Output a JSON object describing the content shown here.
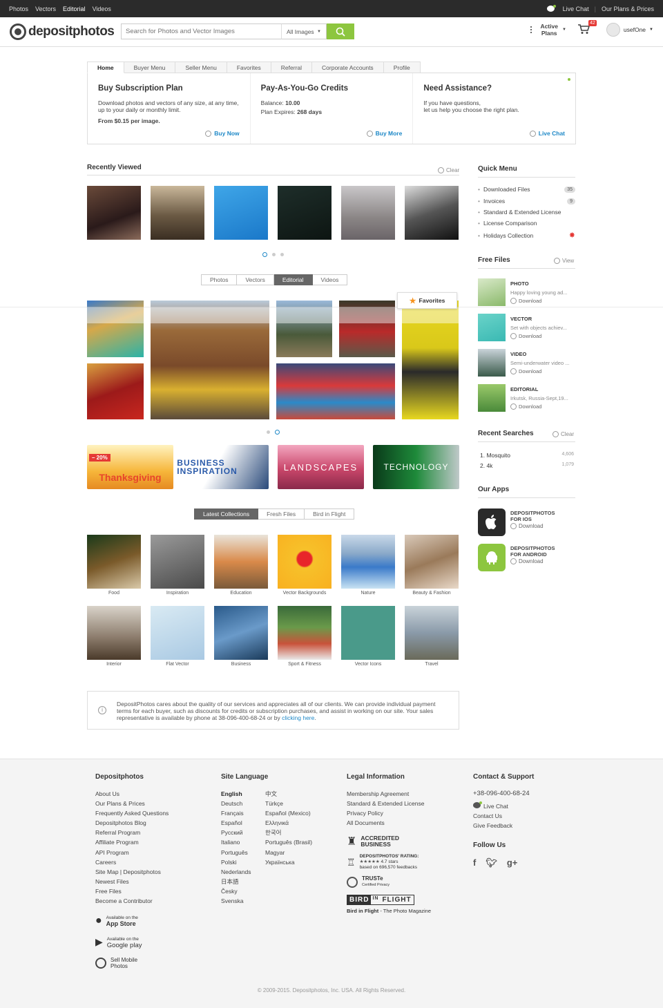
{
  "topbar": {
    "nav": [
      "Photos",
      "Vectors",
      "Editorial",
      "Videos"
    ],
    "live_chat": "Live Chat",
    "plans": "Our Plans & Prices"
  },
  "header": {
    "logo": "depositphotos",
    "search_placeholder": "Search for Photos and Vector Images",
    "search_filter": "All Images",
    "active_plans_1": "Active",
    "active_plans_2": "Plans",
    "cart_count": "42",
    "username": "usefOne"
  },
  "account": {
    "tabs": [
      "Home",
      "Buyer Menu",
      "Seller Menu",
      "Favorites",
      "Referral",
      "Corporate Accounts",
      "Profile"
    ],
    "subscription": {
      "title": "Buy Subscription Plan",
      "text": "Download photos and vectors of any size, at any time, up to your daily or monthly limit.",
      "price_prefix": "From ",
      "price": "$0.15 per image.",
      "link": "Buy Now"
    },
    "credits": {
      "title": "Pay-As-You-Go Credits",
      "balance_label": "Balance: ",
      "balance": "10.00",
      "expires_label": "Plan Expires: ",
      "expires": "268 days",
      "link": "Buy More"
    },
    "assist": {
      "title": "Need Assistance?",
      "line1": "If you have questions,",
      "line2": "let us help you choose the right plan.",
      "link": "Live Chat"
    }
  },
  "recently_viewed": {
    "title": "Recently Viewed",
    "clear": "Clear"
  },
  "media_tabs": [
    "Photos",
    "Vectors",
    "Editorial",
    "Videos"
  ],
  "favorites_label": "Favorites",
  "banners": [
    {
      "text": "Thanksgiving",
      "badge": "– 20%"
    },
    {
      "text": "BUSINESS INSPIRATION"
    },
    {
      "text": "LANDSCAPES"
    },
    {
      "text": "TECHNOLOGY"
    }
  ],
  "collection_tabs": [
    "Latest Collections",
    "Fresh Files",
    "Bird in Flight"
  ],
  "collections": [
    "Food",
    "Inspiration",
    "Education",
    "Vector Backgrounds",
    "Nature",
    "Beauty & Fashion",
    "Interior",
    "Flat Vector",
    "Business",
    "Sport & Fitness",
    "Vector Icons",
    "Travel"
  ],
  "info": {
    "text": "DepositPhotos cares about the quality of our services and appreciates all of our clients. We can provide individual payment terms for each buyer, such as discounts for credits or subscription purchases, and assist in working on our site. Your sales representative is available by phone at 38-096-400-68-24 or by ",
    "link": "clicking here",
    "end": "."
  },
  "quick_menu": {
    "title": "Quick Menu",
    "items": [
      {
        "label": "Downloaded Files",
        "count": "35"
      },
      {
        "label": "Invoices",
        "count": "9"
      },
      {
        "label": "Standard & Extended License",
        "count": ""
      },
      {
        "label": "License Comparison",
        "count": ""
      },
      {
        "label": "Holidays Collection",
        "count": ""
      }
    ]
  },
  "free_files": {
    "title": "Free Files",
    "view": "View",
    "download": "Download",
    "items": [
      {
        "type": "PHOTO",
        "desc": "Happy loving young ad..."
      },
      {
        "type": "VECTOR",
        "desc": "Set with objects achiev..."
      },
      {
        "type": "VIDEO",
        "desc": "Semi-underwater video ..."
      },
      {
        "type": "EDITORIAL",
        "desc": "Irkutsk, Russia-Sept,19..."
      }
    ]
  },
  "recent_searches": {
    "title": "Recent Searches",
    "clear": "Clear",
    "items": [
      {
        "label": "1.  Mosquito",
        "count": "4,606"
      },
      {
        "label": "2.  4k",
        "count": "1,079"
      }
    ]
  },
  "apps": {
    "title": "Our Apps",
    "ios_1": "DEPOSITPHOTOS",
    "ios_2": "FOR IOS",
    "android_1": "DEPOSITPHOTOS",
    "android_2": "FOR ANDROID",
    "download": "Download"
  },
  "footer": {
    "col1_title": "Depositphotos",
    "col1": [
      "About Us",
      "Our Plans & Prices",
      "Frequently Asked Questions",
      "Depositphotos Blog",
      "Referral Program",
      "Affiliate Program",
      "API Program",
      "Careers",
      "Site Map | Depositphotos",
      "Newest Files",
      "Free Files",
      "Become a Contributor"
    ],
    "appstore_small": "Available on the",
    "appstore": "App Store",
    "gplay_small": "Available on the",
    "gplay": "Google play",
    "sell1": "Sell Mobile",
    "sell2": "Photos",
    "col2_title": "Site Language",
    "langs_a": [
      "English",
      "Deutsch",
      "Français",
      "Español",
      "Русский",
      "Italiano",
      "Português",
      "Polski",
      "Nederlands",
      "日本語",
      "Česky",
      "Svenska"
    ],
    "langs_b": [
      "中文",
      "Türkçe",
      "Español (Mexico)",
      "Ελληνικά",
      "한국어",
      "Português (Brasil)",
      "Magyar",
      "Українська"
    ],
    "col3_title": "Legal Information",
    "col3": [
      "Membership Agreement",
      "Standard & Extended License",
      "Privacy Policy",
      "All Documents"
    ],
    "bbb": "ACCREDITED BUSINESS",
    "rating_title": "DEPOSITPHOTOS' RATING:",
    "rating_stars": "4.7 stars",
    "rating_based": "based on 696,570 feedbacks",
    "truste": "TRUSTe",
    "truste_sub": "Certified Privacy",
    "bif_logo_1": "BIRD",
    "bif_logo_2": "IN",
    "bif_logo_3": "FLIGHT",
    "bif_name": "Bird in Flight",
    "bif_desc": " - The Photo Magazine",
    "col4_title": "Contact & Support",
    "phone": "+38-096-400-68-24",
    "col4": [
      "Live Chat",
      "Contact Us",
      "Give Feedback"
    ],
    "follow": "Follow Us",
    "copyright": "© 2009-2015. Depositphotos, Inc. USA. All Rights Reserved."
  }
}
